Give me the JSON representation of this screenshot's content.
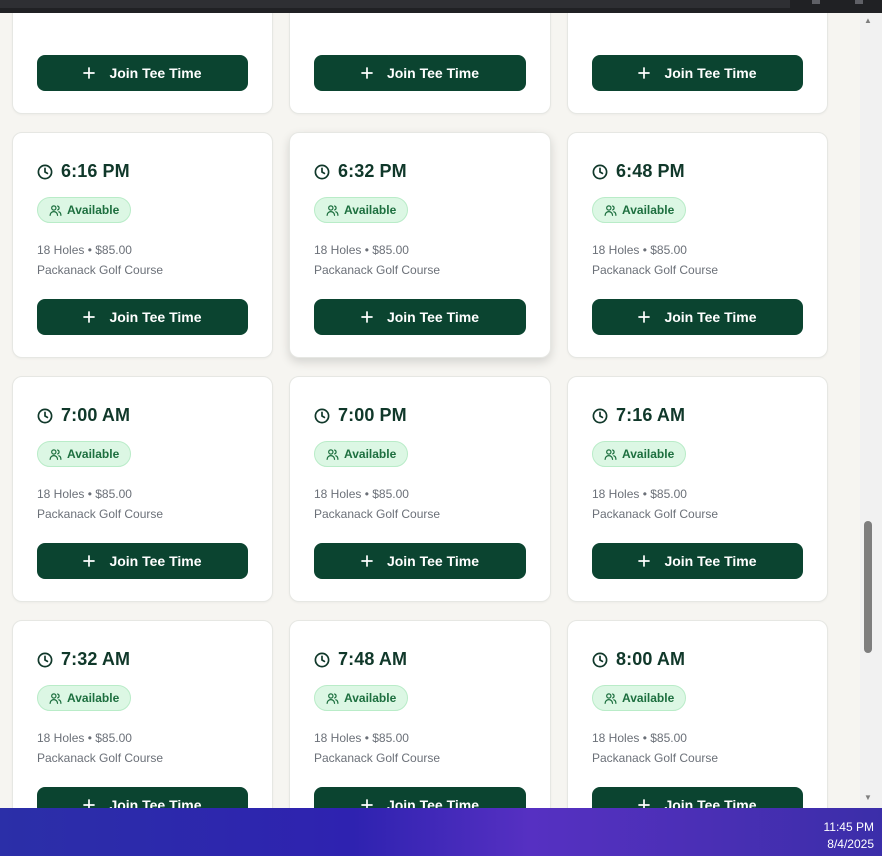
{
  "tee_times": [
    {
      "time": "",
      "status": "",
      "details": "",
      "course": "Packanack Golf Course",
      "button_label": "Join Tee Time"
    },
    {
      "time": "",
      "status": "",
      "details": "",
      "course": "Packanack Golf Course",
      "button_label": "Join Tee Time"
    },
    {
      "time": "",
      "status": "",
      "details": "",
      "course": "Packanack Golf Course",
      "button_label": "Join Tee Time"
    },
    {
      "time": "6:16 PM",
      "status": "Available",
      "details": "18 Holes • $85.00",
      "course": "Packanack Golf Course",
      "button_label": "Join Tee Time"
    },
    {
      "time": "6:32 PM",
      "status": "Available",
      "details": "18 Holes • $85.00",
      "course": "Packanack Golf Course",
      "button_label": "Join Tee Time"
    },
    {
      "time": "6:48 PM",
      "status": "Available",
      "details": "18 Holes • $85.00",
      "course": "Packanack Golf Course",
      "button_label": "Join Tee Time"
    },
    {
      "time": "7:00 AM",
      "status": "Available",
      "details": "18 Holes • $85.00",
      "course": "Packanack Golf Course",
      "button_label": "Join Tee Time"
    },
    {
      "time": "7:00 PM",
      "status": "Available",
      "details": "18 Holes • $85.00",
      "course": "Packanack Golf Course",
      "button_label": "Join Tee Time"
    },
    {
      "time": "7:16 AM",
      "status": "Available",
      "details": "18 Holes • $85.00",
      "course": "Packanack Golf Course",
      "button_label": "Join Tee Time"
    },
    {
      "time": "7:32 AM",
      "status": "Available",
      "details": "18 Holes • $85.00",
      "course": "Packanack Golf Course",
      "button_label": "Join Tee Time"
    },
    {
      "time": "7:48 AM",
      "status": "Available",
      "details": "18 Holes • $85.00",
      "course": "Packanack Golf Course",
      "button_label": "Join Tee Time"
    },
    {
      "time": "8:00 AM",
      "status": "Available",
      "details": "18 Holes • $85.00",
      "course": "Packanack Golf Course",
      "button_label": "Join Tee Time"
    }
  ],
  "taskbar": {
    "time": "11:45 PM",
    "date": "8/4/2025"
  },
  "icons": {
    "time": "clock-icon",
    "status": "users-icon",
    "button": "plus-icon"
  },
  "colors": {
    "primary_button": "#0b4430",
    "time_text": "#10382a",
    "badge_bg": "#dcf7e4",
    "badge_text": "#1d6f3f",
    "page_bg": "#f6f5f1"
  }
}
